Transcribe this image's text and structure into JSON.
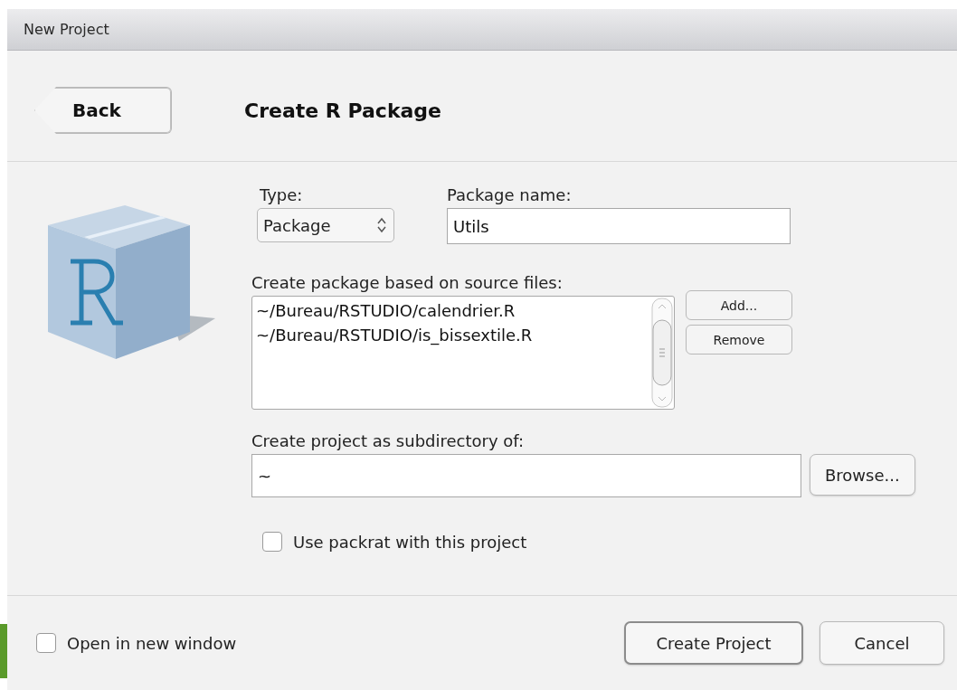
{
  "window": {
    "title": "New Project"
  },
  "header": {
    "back_button": "Back",
    "title": "Create R Package"
  },
  "type": {
    "label": "Type:",
    "value": "Package"
  },
  "package_name": {
    "label": "Package name:",
    "value": "Utils"
  },
  "source_files": {
    "label": "Create package based on source files:",
    "files": [
      "~/Bureau/RSTUDIO/calendrier.R",
      "~/Bureau/RSTUDIO/is_bissextile.R"
    ],
    "buttons": [
      "Add...",
      "Remove"
    ]
  },
  "subdirectory": {
    "label": "Create project as subdirectory of:",
    "value": "~",
    "button": "Browse..."
  },
  "packrat": {
    "label": "Use packrat with this project",
    "checked": false
  },
  "footer": {
    "open_new_window": {
      "label": "Open in new window",
      "checked": false
    },
    "buttons": [
      {
        "label": "Create Project",
        "default": true
      },
      {
        "label": "Cancel",
        "default": false
      }
    ]
  }
}
